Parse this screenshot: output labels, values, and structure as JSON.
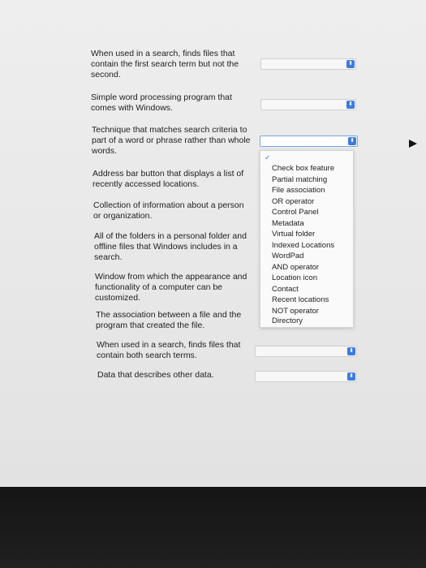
{
  "questions": [
    {
      "text": "When used in a search, finds files that contain the first search term but not the second.",
      "value": ""
    },
    {
      "text": "Simple word processing program that comes with Windows.",
      "value": ""
    },
    {
      "text": "Technique that matches search criteria to part of a word or phrase rather than whole words.",
      "value": ""
    },
    {
      "text": "Address bar button that displays a list of recently accessed locations.",
      "value": ""
    },
    {
      "text": "Collection of information about a person or organization.",
      "value": ""
    },
    {
      "text": "All of the folders in a personal folder and offline files that Windows includes in a search.",
      "value": ""
    },
    {
      "text": "Window from which the appearance and functionality of a computer can be customized.",
      "value": ""
    },
    {
      "text": "The association between a file and the program that created the file.",
      "value": ""
    },
    {
      "text": "When used in a search, finds files that contain both search terms.",
      "value": ""
    },
    {
      "text": "Data that describes other data.",
      "value": ""
    }
  ],
  "dropdown_options": [
    "Check box feature",
    "Partial matching",
    "File association",
    "OR operator",
    "Control Panel",
    "Metadata",
    "Virtual folder",
    "Indexed Locations",
    "WordPad",
    "AND operator",
    "Location icon",
    "Contact",
    "Recent locations",
    "NOT operator",
    "Directory"
  ],
  "icons": {
    "select_arrows": "updown-chevron-icon",
    "check": "checkmark-icon",
    "cursor": "arrow-cursor-icon"
  },
  "colors": {
    "accent": "#3d7bdc"
  }
}
